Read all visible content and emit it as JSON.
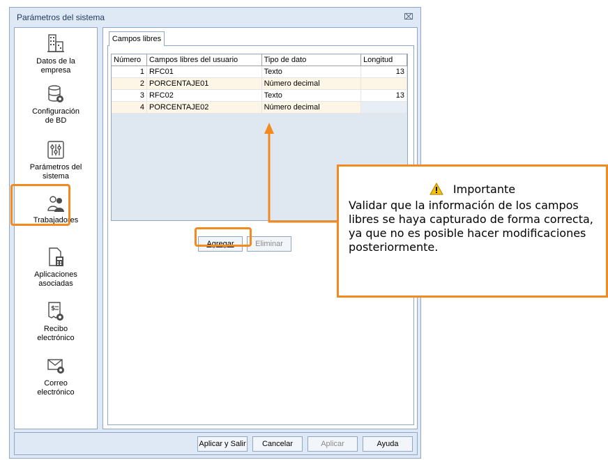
{
  "window": {
    "title": "Parámetros del sistema",
    "close_glyph": "⌧"
  },
  "sidebar": {
    "items": [
      {
        "label": "Datos de la empresa",
        "icon": "building-icon"
      },
      {
        "label": "Configuración de BD",
        "icon": "database-gear-icon"
      },
      {
        "label": "Parámetros del sistema",
        "icon": "sliders-icon"
      },
      {
        "label": "Trabajadores",
        "icon": "users-icon"
      },
      {
        "label": "Aplicaciones asociadas",
        "icon": "document-calculator-icon"
      },
      {
        "label": "Recibo electrónico",
        "icon": "receipt-gear-icon"
      },
      {
        "label": "Correo electrónico",
        "icon": "envelope-gear-icon"
      }
    ]
  },
  "tab": {
    "label": "Campos libres"
  },
  "grid": {
    "columns": [
      "Número",
      "Campos libres del usuario",
      "Tipo de dato",
      "Longitud"
    ],
    "rows": [
      {
        "num": "1",
        "campo": "RFC01",
        "tipo": "Texto",
        "longitud": "13"
      },
      {
        "num": "2",
        "campo": "PORCENTAJE01",
        "tipo": "Número decimal",
        "longitud": ""
      },
      {
        "num": "3",
        "campo": "RFC02",
        "tipo": "Texto",
        "longitud": "13"
      },
      {
        "num": "4",
        "campo": "PORCENTAJE02",
        "tipo": "Número decimal",
        "longitud": ""
      }
    ]
  },
  "buttons": {
    "agregar": "Agregar",
    "eliminar": "Eliminar"
  },
  "footer": {
    "aplicar_salir": "Aplicar y Salir",
    "cancelar": "Cancelar",
    "aplicar": "Aplicar",
    "ayuda": "Ayuda"
  },
  "callout": {
    "title": "Importante",
    "body": "Validar que la información de los campos libres se haya capturado de forma correcta, ya que no es posible hacer modificaciones posteriormente."
  },
  "colors": {
    "accent": "#f28a1f",
    "window_bg": "#dfe8f5",
    "border": "#8fa7c7",
    "warning": "#f5c400"
  }
}
